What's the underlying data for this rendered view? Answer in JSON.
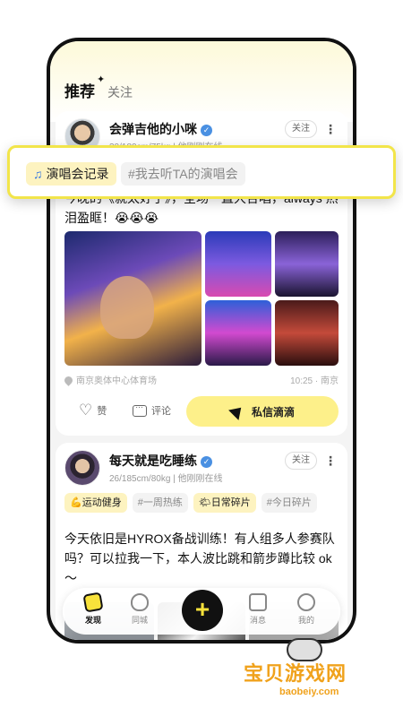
{
  "tabs": {
    "recommended": "推荐",
    "following": "关注"
  },
  "post1": {
    "username": "会弹吉他的小咪",
    "meta_stats": "30/180cm/75kg",
    "meta_status": "他刚刚在线",
    "follow": "关注",
    "text": "今晚的《就太好了》，全场一直大合唱，always 热泪盈眶！😭😭😭",
    "location": "南京奥体中心体育场",
    "time_city": "10:25 · 南京",
    "like": "赞",
    "comment": "评论",
    "dm": "私信滴滴"
  },
  "callout": {
    "topic": "演唱会记录",
    "hashtag": "#我去听TA的演唱会"
  },
  "post2": {
    "username": "每天就是吃睡练",
    "meta_stats": "26/185cm/80kg",
    "meta_status": "他刚刚在线",
    "follow": "关注",
    "topic1": "💪运动健身",
    "hash1": "#一周热练",
    "topic2": "🌤日常碎片",
    "hash2": "#今日碎片",
    "text": "今天依旧是HYROX备战训练！有人组多人参赛队吗？可以拉我一下，本人波比跳和箭步蹲比较 ok～"
  },
  "nav": {
    "discover": "发现",
    "nearby": "同城",
    "message": "消息",
    "me": "我的",
    "plus": "+"
  },
  "watermark": {
    "text": "宝贝游戏网",
    "url": "baobeiy.com"
  },
  "colors": {
    "accent_yellow": "#f8e23b",
    "chip_bg": "#fdf3c0",
    "dm_bg": "#fdf08a",
    "verified_blue": "#4a90e2"
  }
}
